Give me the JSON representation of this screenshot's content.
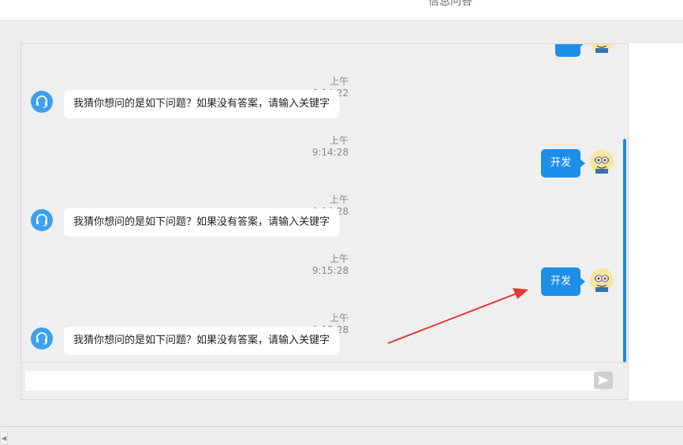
{
  "header": {
    "title": "信息问答"
  },
  "messages": [
    {
      "type": "bot",
      "time": "上午9:14:22",
      "text": "我猜你想问的是如下问题？如果没有答案，请输入关键字"
    },
    {
      "type": "user",
      "time": "上午9:14:28",
      "text": "开发"
    },
    {
      "type": "bot",
      "time": "上午9:14:28",
      "text": "我猜你想问的是如下问题？如果没有答案，请输入关键字"
    },
    {
      "type": "user",
      "time": "上午9:15:28",
      "text": "开发"
    },
    {
      "type": "bot",
      "time": "上午9:15:28",
      "text": "我猜你想问的是如下问题？如果没有答案，请输入关键字"
    }
  ],
  "input": {
    "value": "",
    "placeholder": ""
  },
  "colors": {
    "accent": "#1e8fe8",
    "bot_avatar": "#3ea0ee",
    "annotation_arrow": "#e53935"
  },
  "icons": {
    "bot_avatar": "headset-icon",
    "user_avatar": "minion-avatar-icon",
    "send": "send-icon"
  }
}
